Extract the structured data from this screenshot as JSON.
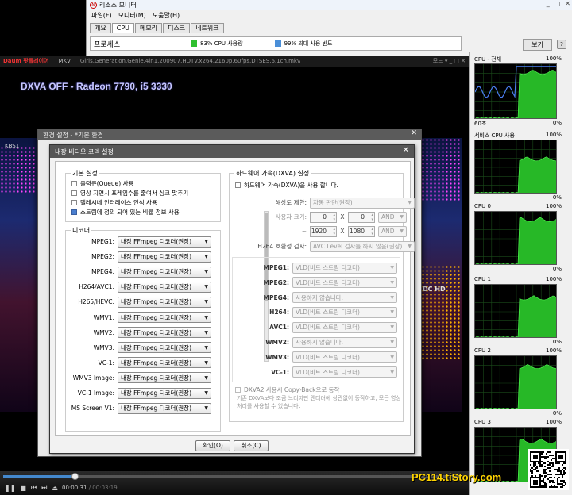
{
  "resource_monitor": {
    "title": "리소스 모니터",
    "window_buttons": [
      "_",
      "□",
      "✕"
    ],
    "menu": [
      "파일(F)",
      "모니터(M)",
      "도움말(H)"
    ],
    "tabs": [
      "개요",
      "CPU",
      "메모리",
      "디스크",
      "네트워크"
    ],
    "active_tab": "CPU",
    "process_label": "프로세스",
    "cpu_usage": "83% CPU 사용량",
    "max_freq": "99% 최대 사용 빈도",
    "cpu_usage_color": "#2fbf2f",
    "max_freq_color": "#4a8fd8",
    "view_button": "보기",
    "help_icon": "?"
  },
  "cpu_graphs": [
    {
      "title": "CPU - 전체",
      "max": "100%",
      "min": "0%",
      "time": "60초",
      "level": 0.9
    },
    {
      "title": "서비스 CPU 사용",
      "max": "100%",
      "min": "0%",
      "time": "",
      "level": 0.7
    },
    {
      "title": "CPU 0",
      "max": "100%",
      "min": "0%",
      "time": "",
      "level": 0.9
    },
    {
      "title": "CPU 1",
      "max": "100%",
      "min": "0%",
      "time": "",
      "level": 0.8
    },
    {
      "title": "CPU 2",
      "max": "100%",
      "min": "0%",
      "time": "",
      "level": 0.85
    },
    {
      "title": "CPU 3",
      "max": "100%",
      "min": "",
      "time": "",
      "level": 0.8
    }
  ],
  "player": {
    "brand": "Daum 팟플레이어",
    "format": "MKV",
    "filename": "Girls.Generation.Genie.4in1.200907.HDTV.x264.2160p.60fps.DTSES.6.1ch.mkv",
    "window_buttons": "모드 ▾  _  □  ✕",
    "osd_text": "DXVA OFF - Radeon 7790, i5 3330",
    "osd_sub": "",
    "channel_logo": "KBS1",
    "hd_logo": "DC HD",
    "time_current": "00:00:31",
    "time_total": "/ 00:03:19",
    "progress": 0.156
  },
  "env_dialog": {
    "title": "환경 설정 - *기본 환경",
    "close": "✕"
  },
  "codec_dialog": {
    "title": "내장 비디오 코덱 설정",
    "close": "✕",
    "basic": {
      "title": "기본 설정",
      "options": [
        {
          "label": "출력큐(Queue) 사용",
          "checked": false
        },
        {
          "label": "영상 지연시 프레임수를 줄여서 싱크 맞추기",
          "checked": false
        },
        {
          "label": "텔레시네 인터레이스 인식 사용",
          "checked": false
        },
        {
          "label": "스트림에 정의 되어 있는 비율 정보 사용",
          "checked": true
        }
      ]
    },
    "decoders": {
      "title": "디코더",
      "rows": [
        {
          "label": "MPEG1:",
          "value": "내장 FFmpeg 디코더(권장)"
        },
        {
          "label": "MPEG2:",
          "value": "내장 FFmpeg 디코더(권장)"
        },
        {
          "label": "MPEG4:",
          "value": "내장 FFmpeg 디코더(권장)"
        },
        {
          "label": "H264/AVC1:",
          "value": "내장 FFmpeg 디코더(권장)"
        },
        {
          "label": "H265/HEVC:",
          "value": "내장 FFmpeg 디코더(권장)"
        },
        {
          "label": "WMV1:",
          "value": "내장 FFmpeg 디코더(권장)"
        },
        {
          "label": "WMV2:",
          "value": "내장 FFmpeg 디코더(권장)"
        },
        {
          "label": "WMV3:",
          "value": "내장 FFmpeg 디코더(권장)"
        },
        {
          "label": "VC-1:",
          "value": "내장 FFmpeg 디코더(권장)"
        },
        {
          "label": "WMV3 Image:",
          "value": "내장 FFmpeg 디코더(권장)"
        },
        {
          "label": "VC-1 Image:",
          "value": "내장 FFmpeg 디코더(권장)"
        },
        {
          "label": "MS Screen V1:",
          "value": "내장 FFmpeg 디코더(권장)"
        }
      ]
    },
    "hw": {
      "title": "하드웨어 가속(DXVA) 설정",
      "enable_label": "하드웨어 가속(DXVA)을 사용 합니다.",
      "enable_checked": false,
      "res_limit_label": "해상도 제한:",
      "res_limit_value": "자동 판단(권장)",
      "user_size_label": "사용자 크기:",
      "min_w": "0",
      "min_h": "0",
      "min_op": "AND",
      "tilde": "~",
      "max_w": "1920",
      "max_h": "1080",
      "max_op": "AND",
      "x_sep": "X",
      "h264_label": "H264 호환성 검사:",
      "h264_value": "AVC Level 검사를 하지 않음(권장)",
      "codecs": [
        {
          "label": "MPEG1:",
          "value": "VLD(비트 스트림 디코더)"
        },
        {
          "label": "MPEG2:",
          "value": "VLD(비트 스트림 디코더)"
        },
        {
          "label": "MPEG4:",
          "value": "사용하지 않습니다."
        },
        {
          "label": "H264:",
          "value": "VLD(비트 스트림 디코더)"
        },
        {
          "label": "AVC1:",
          "value": "VLD(비트 스트림 디코더)"
        },
        {
          "label": "WMV2:",
          "value": "사용하지 않습니다."
        },
        {
          "label": "WMV3:",
          "value": "VLD(비트 스트림 디코더)"
        },
        {
          "label": "VC-1:",
          "value": "VLD(비트 스트림 디코더)"
        }
      ],
      "dxva2_label": "DXVA2 사용시 Copy-Back으로 동작",
      "dxva2_checked": false,
      "note": "기존 DXVA보다 조금 느리지만 렌더러에 상관없이 동작하고, 모든 영상 처리를 사용할 수 있습니다."
    },
    "ok": "확인(O)",
    "cancel": "취소(C)"
  },
  "watermark": "PC114.tiStory.com"
}
